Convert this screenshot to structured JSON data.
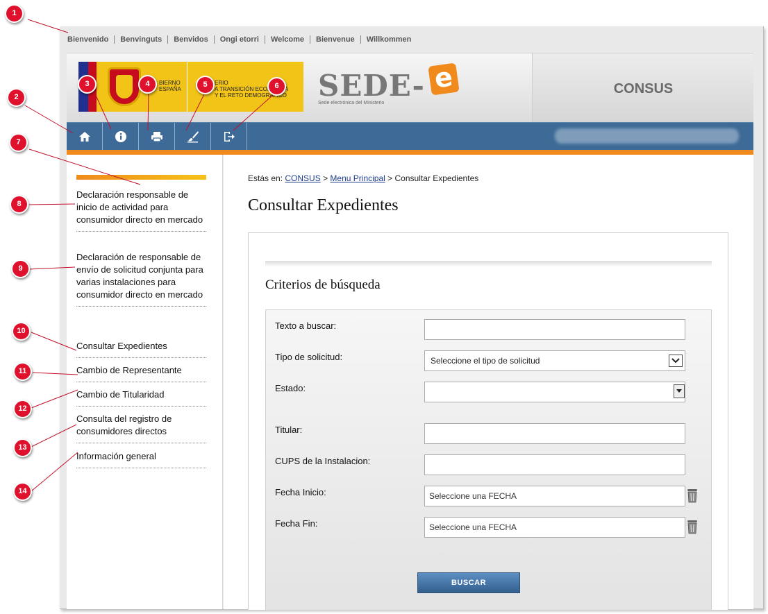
{
  "languages": [
    "Bienvenido",
    "Benvinguts",
    "Benvidos",
    "Ongi etorri",
    "Welcome",
    "Bienvenue",
    "Willkommen"
  ],
  "header": {
    "gov_text_1": "BIERNO\nESPAÑA",
    "gov_text_2": "ERIO\nA TRANSICIÓN ECOLÓGICA\nY EL RETO DEMOGRÁFICO",
    "sede_title": "SEDE-",
    "sede_e": "e",
    "sede_subtitle": "Sede electrónica del Ministerio",
    "app_title": "CONSUS"
  },
  "toolbar": {
    "icons": [
      "home-icon",
      "info-icon",
      "print-icon",
      "brush-icon",
      "logout-icon"
    ],
    "user_name_blurred": true
  },
  "sidebar": {
    "items": [
      {
        "label": "Declaración responsable de inicio de actividad para consumidor directo en mercado"
      },
      {
        "label": "Declaración de responsable de envío de solicitud conjunta para varias instalaciones para consumidor directo en mercado"
      },
      {
        "label": "Consultar Expedientes"
      },
      {
        "label": "Cambio de Representante"
      },
      {
        "label": "Cambio de Titularidad"
      },
      {
        "label": "Consulta del registro de consumidores directos"
      },
      {
        "label": "Información general"
      }
    ]
  },
  "breadcrumb": {
    "prefix": "Estás en:",
    "link1": "CONSUS",
    "sep1": ">",
    "link2": "Menu Principal",
    "sep2": ">",
    "current": "Consultar Expedientes"
  },
  "page_title": "Consultar Expedientes",
  "search": {
    "title": "Criterios de búsqueda",
    "fields": {
      "texto": {
        "label": "Texto a buscar:",
        "value": ""
      },
      "tipo": {
        "label": "Tipo de solicitud:",
        "selected": "Seleccione el tipo de solicitud"
      },
      "estado": {
        "label": "Estado:",
        "selected": ""
      },
      "titular": {
        "label": "Titular:",
        "value": ""
      },
      "cups": {
        "label": "CUPS de la Instalacion:",
        "value": ""
      },
      "fecha_inicio": {
        "label": "Fecha Inicio:",
        "placeholder": "Seleccione una FECHA"
      },
      "fecha_fin": {
        "label": "Fecha Fin:",
        "placeholder": "Seleccione una FECHA"
      }
    },
    "button": "BUSCAR"
  },
  "callouts": [
    "1",
    "2",
    "3",
    "4",
    "5",
    "6",
    "7",
    "8",
    "9",
    "10",
    "11",
    "12",
    "13",
    "14"
  ],
  "colors": {
    "callout": "#e0112c",
    "toolbar": "#3d6a96",
    "accent_orange": "#f08a1c",
    "gov_yellow": "#f2c418",
    "link": "#1e3e8f"
  }
}
